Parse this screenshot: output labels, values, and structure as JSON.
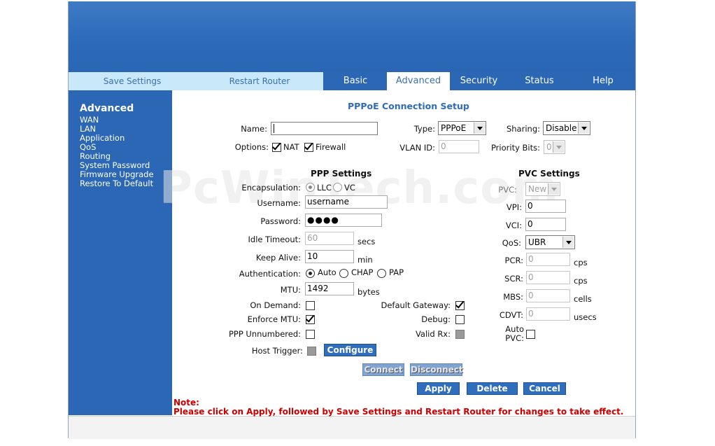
{
  "nav": {
    "links": [
      "Save Settings",
      "Restart Router"
    ],
    "tabs": [
      "Basic",
      "Advanced",
      "Security",
      "Status",
      "Help"
    ],
    "active_tab": "Advanced"
  },
  "sidebar": {
    "title": "Advanced",
    "items": [
      "WAN",
      "LAN",
      "Application",
      "QoS",
      "Routing",
      "System Password",
      "Firmware Upgrade",
      "Restore To Default"
    ]
  },
  "page_title": "PPPoE Connection Setup",
  "watermark": "PcWinTech.com",
  "top": {
    "name_label": "Name:",
    "name_value": "",
    "type_label": "Type:",
    "type_value": "PPPoE",
    "sharing_label": "Sharing:",
    "sharing_value": "Disable",
    "options_label": "Options:",
    "nat_label": "NAT",
    "firewall_label": "Firewall",
    "vlan_label": "VLAN ID:",
    "vlan_value": "0",
    "priority_label": "Priority Bits:",
    "priority_value": "0"
  },
  "ppp": {
    "title": "PPP Settings",
    "encapsulation_label": "Encapsulation:",
    "llc_label": "LLC",
    "vc_label": "VC",
    "username_label": "Username:",
    "username_value": "username",
    "password_label": "Password:",
    "password_value": "●●●●",
    "idle_label": "Idle Timeout:",
    "idle_value": "60",
    "idle_unit": "secs",
    "keepalive_label": "Keep Alive:",
    "keepalive_value": "10",
    "keepalive_unit": "min",
    "auth_label": "Authentication:",
    "auth_auto": "Auto",
    "auth_chap": "CHAP",
    "auth_pap": "PAP",
    "mtu_label": "MTU:",
    "mtu_value": "1492",
    "mtu_unit": "bytes",
    "on_demand_label": "On Demand:",
    "enforce_mtu_label": "Enforce MTU:",
    "unnumbered_label": "PPP Unnumbered:",
    "host_trigger_label": "Host Trigger:",
    "configure_label": "Configure",
    "default_gateway_label": "Default Gateway:",
    "debug_label": "Debug:",
    "valid_rx_label": "Valid Rx:"
  },
  "pvc": {
    "title": "PVC Settings",
    "pvc_label": "PVC:",
    "pvc_value": "New",
    "vpi_label": "VPI:",
    "vpi_value": "0",
    "vci_label": "VCI:",
    "vci_value": "0",
    "qos_label": "QoS:",
    "qos_value": "UBR",
    "pcr_label": "PCR:",
    "pcr_value": "0",
    "pcr_unit": "cps",
    "scr_label": "SCR:",
    "scr_value": "0",
    "scr_unit": "cps",
    "mbs_label": "MBS:",
    "mbs_value": "0",
    "mbs_unit": "cells",
    "cdvt_label": "CDVT:",
    "cdvt_value": "0",
    "cdvt_unit": "usecs",
    "auto_pvc_label_1": "Auto",
    "auto_pvc_label_2": "PVC:"
  },
  "buttons": {
    "connect": "Connect",
    "disconnect": "Disconnect",
    "apply": "Apply",
    "delete": "Delete",
    "cancel": "Cancel"
  },
  "note": {
    "title": "Note:",
    "text": "Please click on Apply, followed by Save Settings and Restart Router for changes to take effect."
  }
}
